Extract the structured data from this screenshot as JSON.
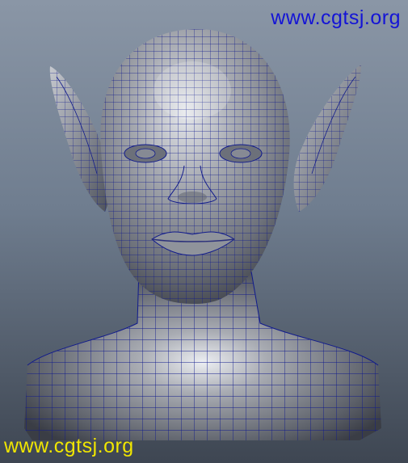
{
  "viewport": {
    "background_top": "#8a96a6",
    "background_bottom": "#3e4652"
  },
  "model": {
    "subject": "head-bust",
    "display_mode": "wireframe-on-shaded",
    "wire_color": "#101a8c",
    "surface_color": "#9a9ca2",
    "highlight_color": "#e8eaee"
  },
  "watermarks": {
    "top": {
      "text": "www.cgtsj.org",
      "color": "#1414d6"
    },
    "bottom": {
      "text": "www.cgtsj.org",
      "color": "#f0e600"
    }
  }
}
